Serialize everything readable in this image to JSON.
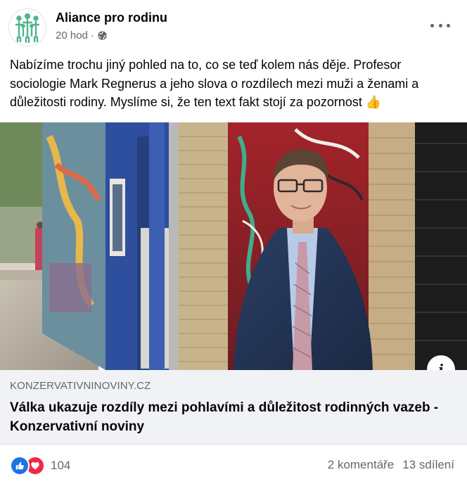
{
  "post": {
    "page_name": "Aliance pro rodinu",
    "time": "20 hod",
    "separator": "·",
    "privacy_icon": "globe-icon",
    "more_icon": "more-options-icon",
    "text": "Nabízíme trochu jiný pohled na to, co se teď kolem nás děje. Profesor sociologie Mark Regnerus a jeho slova o rozdílech mezi muži a ženami a důležitosti rodiny. Myslíme si, že ten text fakt stojí za pozornost",
    "text_emoji": "👍"
  },
  "link": {
    "domain": "KONZERVATIVNINOVINY.CZ",
    "title": "Válka ukazuje rozdíly mezi pohlavími a důležitost rodinných vazeb - Konzervativní noviny",
    "info_label": "i"
  },
  "footer": {
    "reaction_icons": [
      "like-icon",
      "love-icon"
    ],
    "reaction_count": "104",
    "comments": "2 komentáře",
    "shares": "13 sdílení"
  },
  "colors": {
    "like": "#1b74e4",
    "love": "#f02849",
    "secondary_text": "#65676b",
    "card_bg": "#f0f2f5"
  }
}
